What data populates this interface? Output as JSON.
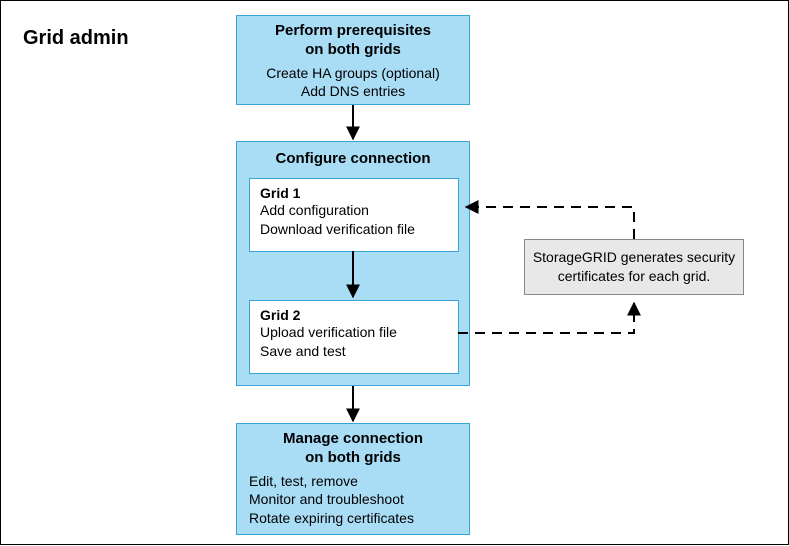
{
  "title": "Grid admin",
  "prereq": {
    "heading_l1": "Perform prerequisites",
    "heading_l2": "on both grids",
    "line1": "Create HA groups (optional)",
    "line2": "Add DNS entries"
  },
  "configure": {
    "heading": "Configure connection",
    "grid1": {
      "heading": "Grid 1",
      "line1": "Add configuration",
      "line2": "Download verification file"
    },
    "grid2": {
      "heading": "Grid 2",
      "line1": "Upload verification file",
      "line2": "Save and test"
    }
  },
  "note": {
    "line1": "StorageGRID generates security",
    "line2": "certificates for each grid."
  },
  "manage": {
    "heading_l1": "Manage connection",
    "heading_l2": "on both grids",
    "line1": "Edit, test, remove",
    "line2": "Monitor and troubleshoot",
    "line3": "Rotate expiring certificates"
  }
}
